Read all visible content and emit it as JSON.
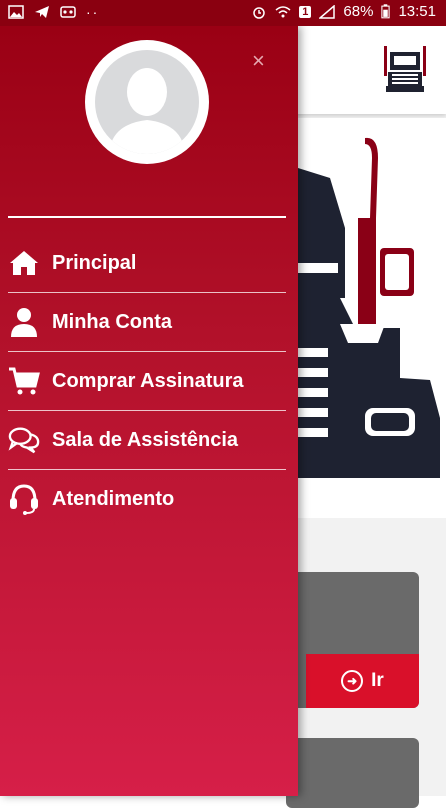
{
  "status_bar": {
    "battery_percent": "68%",
    "time": "13:51",
    "notification_count": "1"
  },
  "drawer": {
    "close_symbol": "×",
    "menu": [
      {
        "label": "Principal",
        "icon": "home-icon"
      },
      {
        "label": "Minha Conta",
        "icon": "user-icon"
      },
      {
        "label": "Comprar Assinatura",
        "icon": "cart-icon"
      },
      {
        "label": "Sala de Assistência",
        "icon": "chat-icon"
      },
      {
        "label": "Atendimento",
        "icon": "headset-icon"
      }
    ]
  },
  "cards": {
    "go_label": "Ir"
  },
  "colors": {
    "drawer_top": "#9a0014",
    "drawer_bottom": "#d61f48",
    "accent": "#d9102a"
  }
}
